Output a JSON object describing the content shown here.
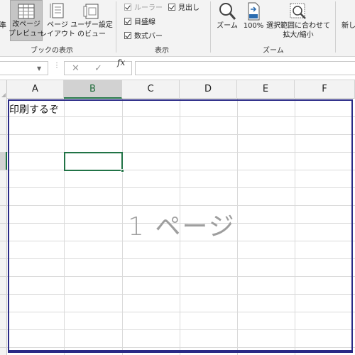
{
  "ribbon": {
    "views": {
      "partial_label": "準",
      "page_break_preview": [
        "改ページ",
        "プレビュー"
      ],
      "page_layout": [
        "ページ",
        "レイアウト"
      ],
      "custom_view": [
        "ユーザー設定",
        "のビュー"
      ],
      "group_label": "ブックの表示"
    },
    "show": {
      "ruler": "ルーラー",
      "gridlines": "目盛線",
      "formula_bar": "数式バー",
      "headings": "見出し",
      "ruler_checked": true,
      "gridlines_checked": true,
      "formula_bar_checked": true,
      "headings_checked": true,
      "group_label": "表示"
    },
    "zoom": {
      "zoom": "ズーム",
      "zoom100": "100%",
      "zoom_selection": [
        "選択範囲に合わせて",
        "拡大/縮小"
      ],
      "group_label": "ズーム"
    },
    "window": {
      "partial_label": "新し"
    }
  },
  "formula_bar": {
    "fx": "fx",
    "cancel_icon": "✕",
    "enter_icon": "✓",
    "value": ""
  },
  "sheet": {
    "columns": [
      "A",
      "B",
      "C",
      "D",
      "E",
      "F"
    ],
    "selected_column": "B",
    "cell_a1": "印刷するぞ",
    "page_watermark": "1 ページ"
  },
  "colors": {
    "accent": "#217346",
    "page_border": "#2a2a86"
  }
}
